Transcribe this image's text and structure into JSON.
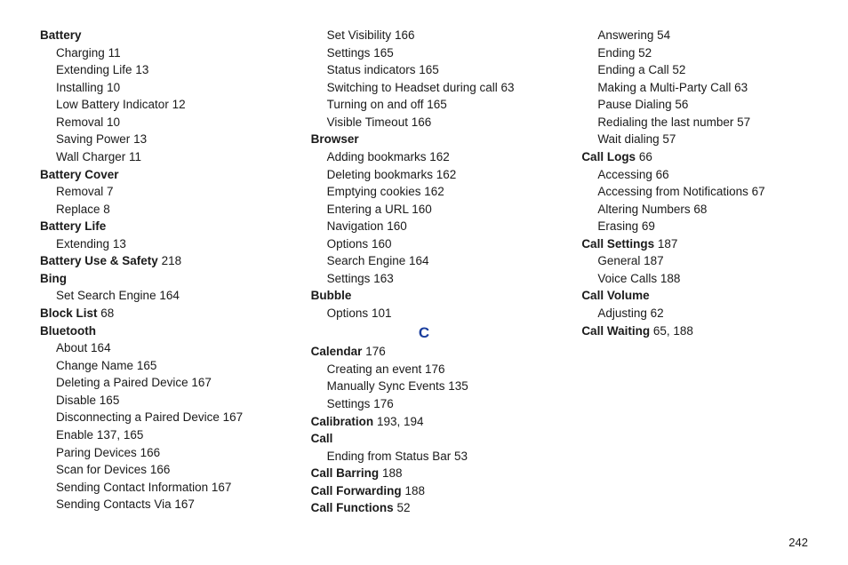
{
  "page_number": "242",
  "entries": [
    {
      "type": "top",
      "term": "Battery",
      "pages": ""
    },
    {
      "type": "sub",
      "term": "Charging",
      "pages": "11"
    },
    {
      "type": "sub",
      "term": "Extending Life",
      "pages": "13"
    },
    {
      "type": "sub",
      "term": "Installing",
      "pages": "10"
    },
    {
      "type": "sub",
      "term": "Low Battery Indicator",
      "pages": "12"
    },
    {
      "type": "sub",
      "term": "Removal",
      "pages": "10"
    },
    {
      "type": "sub",
      "term": "Saving Power",
      "pages": "13"
    },
    {
      "type": "sub",
      "term": "Wall Charger",
      "pages": "11"
    },
    {
      "type": "top",
      "term": "Battery Cover",
      "pages": ""
    },
    {
      "type": "sub",
      "term": "Removal",
      "pages": "7"
    },
    {
      "type": "sub",
      "term": "Replace",
      "pages": "8"
    },
    {
      "type": "top",
      "term": "Battery Life",
      "pages": ""
    },
    {
      "type": "sub",
      "term": "Extending",
      "pages": "13"
    },
    {
      "type": "top",
      "term": "Battery Use & Safety",
      "pages": "218"
    },
    {
      "type": "top",
      "term": "Bing",
      "pages": ""
    },
    {
      "type": "sub",
      "term": "Set Search Engine",
      "pages": "164"
    },
    {
      "type": "top",
      "term": "Block List",
      "pages": "68"
    },
    {
      "type": "top",
      "term": "Bluetooth",
      "pages": ""
    },
    {
      "type": "sub",
      "term": "About",
      "pages": "164"
    },
    {
      "type": "sub",
      "term": "Change Name",
      "pages": "165"
    },
    {
      "type": "sub",
      "term": "Deleting a Paired Device",
      "pages": "167"
    },
    {
      "type": "sub",
      "term": "Disable",
      "pages": "165"
    },
    {
      "type": "sub",
      "term": "Disconnecting a Paired Device",
      "pages": "167"
    },
    {
      "type": "sub",
      "term": "Enable",
      "pages": "137, 165"
    },
    {
      "type": "sub",
      "term": "Paring Devices",
      "pages": "166"
    },
    {
      "type": "sub",
      "term": "Scan for Devices",
      "pages": "166"
    },
    {
      "type": "sub",
      "term": "Sending Contact Information",
      "pages": "167"
    },
    {
      "type": "sub",
      "term": "Sending Contacts Via",
      "pages": "167"
    },
    {
      "type": "sub",
      "term": "Set Visibility",
      "pages": "166"
    },
    {
      "type": "sub",
      "term": "Settings",
      "pages": "165"
    },
    {
      "type": "sub",
      "term": "Status indicators",
      "pages": "165"
    },
    {
      "type": "sub",
      "term": "Switching to Headset during call",
      "pages": "63"
    },
    {
      "type": "sub",
      "term": "Turning on and off",
      "pages": "165"
    },
    {
      "type": "sub",
      "term": "Visible Timeout",
      "pages": "166"
    },
    {
      "type": "top",
      "term": "Browser",
      "pages": ""
    },
    {
      "type": "sub",
      "term": "Adding bookmarks",
      "pages": "162"
    },
    {
      "type": "sub",
      "term": "Deleting bookmarks",
      "pages": "162"
    },
    {
      "type": "sub",
      "term": "Emptying cookies",
      "pages": "162"
    },
    {
      "type": "sub",
      "term": "Entering a URL",
      "pages": "160"
    },
    {
      "type": "sub",
      "term": "Navigation",
      "pages": "160"
    },
    {
      "type": "sub",
      "term": "Options",
      "pages": "160"
    },
    {
      "type": "sub",
      "term": "Search Engine",
      "pages": "164"
    },
    {
      "type": "sub",
      "term": "Settings",
      "pages": "163"
    },
    {
      "type": "top",
      "term": "Bubble",
      "pages": ""
    },
    {
      "type": "sub",
      "term": "Options",
      "pages": "101"
    },
    {
      "type": "letter",
      "term": "C"
    },
    {
      "type": "top",
      "term": "Calendar",
      "pages": "176"
    },
    {
      "type": "sub",
      "term": "Creating an event",
      "pages": "176"
    },
    {
      "type": "sub",
      "term": "Manually Sync Events",
      "pages": "135"
    },
    {
      "type": "sub",
      "term": "Settings",
      "pages": "176"
    },
    {
      "type": "top",
      "term": "Calibration",
      "pages": "193, 194"
    },
    {
      "type": "top",
      "term": "Call",
      "pages": ""
    },
    {
      "type": "sub",
      "term": "Ending from Status Bar",
      "pages": "53"
    },
    {
      "type": "top",
      "term": "Call Barring",
      "pages": "188"
    },
    {
      "type": "top",
      "term": "Call Forwarding",
      "pages": "188"
    },
    {
      "type": "top",
      "term": "Call Functions",
      "pages": "52"
    },
    {
      "type": "sub",
      "term": "Answering",
      "pages": "54"
    },
    {
      "type": "sub",
      "term": "Ending",
      "pages": "52"
    },
    {
      "type": "sub",
      "term": "Ending a Call",
      "pages": "52"
    },
    {
      "type": "sub",
      "term": "Making a Multi-Party Call",
      "pages": "63"
    },
    {
      "type": "sub",
      "term": "Pause Dialing",
      "pages": "56"
    },
    {
      "type": "sub",
      "term": "Redialing the last number",
      "pages": "57"
    },
    {
      "type": "sub",
      "term": "Wait dialing",
      "pages": "57"
    },
    {
      "type": "top",
      "term": "Call Logs",
      "pages": "66"
    },
    {
      "type": "sub",
      "term": "Accessing",
      "pages": "66"
    },
    {
      "type": "sub",
      "term": "Accessing from Notifications",
      "pages": "67"
    },
    {
      "type": "sub",
      "term": "Altering Numbers",
      "pages": "68"
    },
    {
      "type": "sub",
      "term": "Erasing",
      "pages": "69"
    },
    {
      "type": "top",
      "term": "Call Settings",
      "pages": "187"
    },
    {
      "type": "sub",
      "term": "General",
      "pages": "187"
    },
    {
      "type": "sub",
      "term": "Voice Calls",
      "pages": "188"
    },
    {
      "type": "top",
      "term": "Call Volume",
      "pages": ""
    },
    {
      "type": "sub",
      "term": "Adjusting",
      "pages": "62"
    },
    {
      "type": "top",
      "term": "Call Waiting",
      "pages": "65, 188"
    }
  ]
}
